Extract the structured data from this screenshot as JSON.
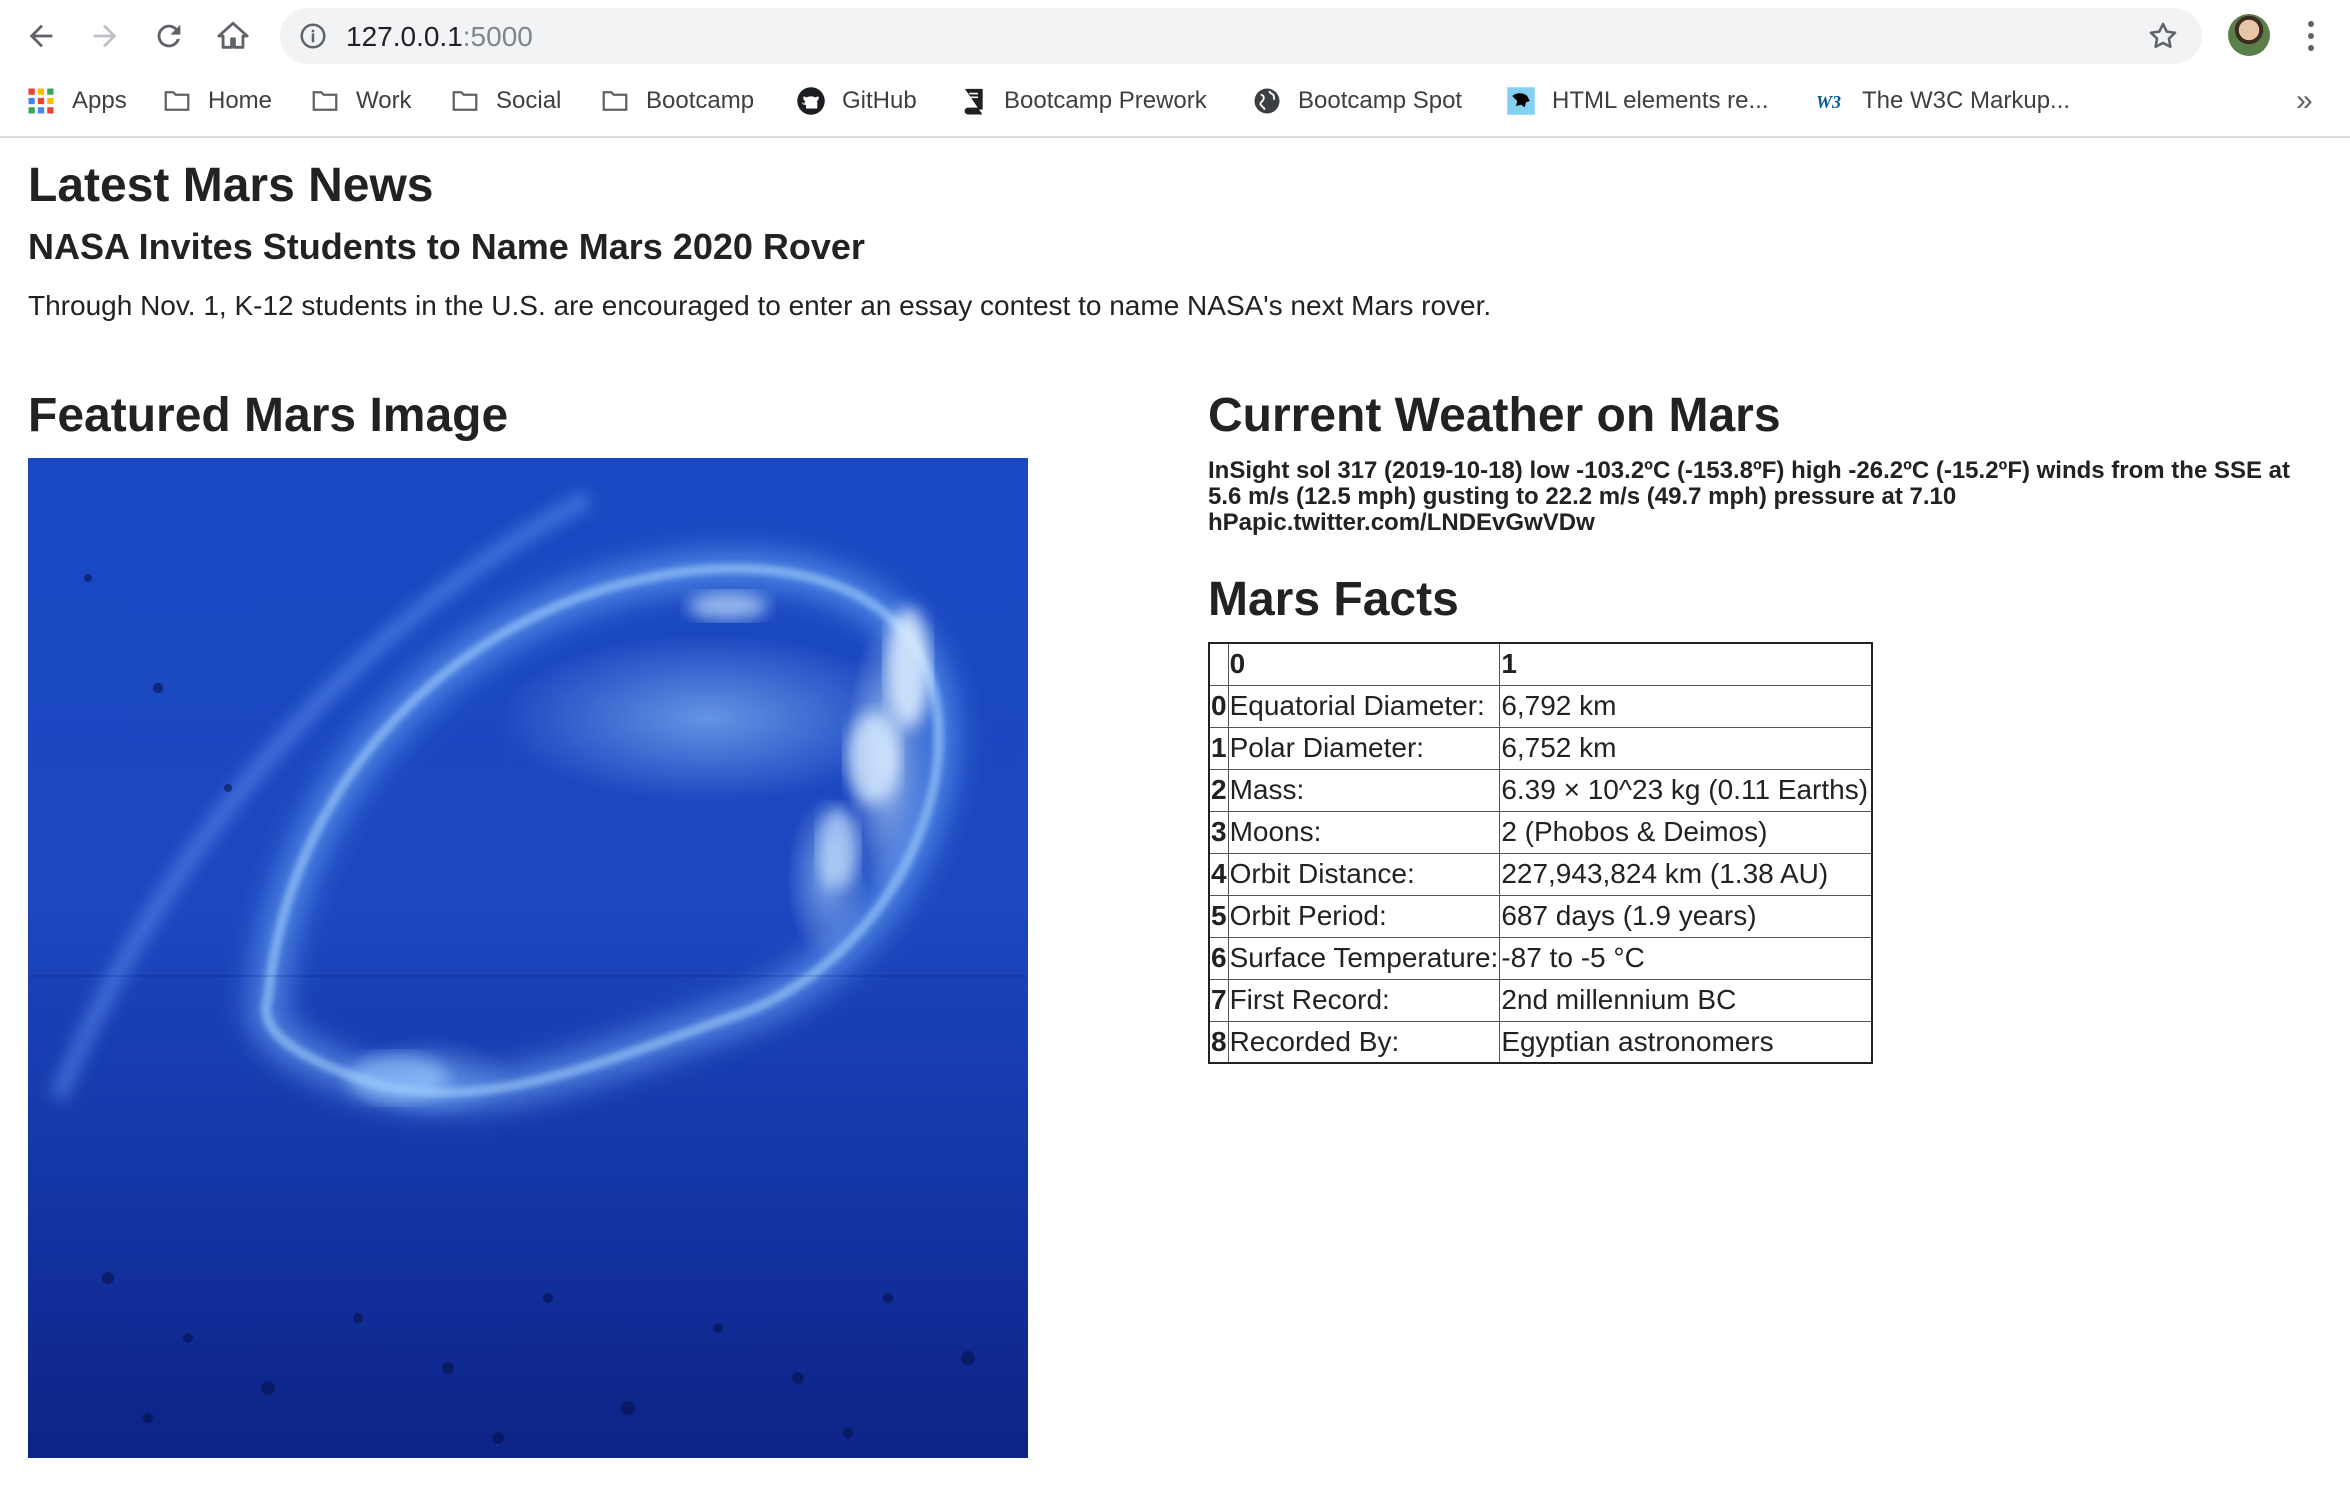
{
  "browser": {
    "url_host": "127.0.0.1",
    "url_port": ":5000",
    "bookmarks": [
      {
        "label": "Apps",
        "icon": "apps-grid-icon"
      },
      {
        "label": "Home",
        "icon": "folder-icon"
      },
      {
        "label": "Work",
        "icon": "folder-icon"
      },
      {
        "label": "Social",
        "icon": "folder-icon"
      },
      {
        "label": "Bootcamp",
        "icon": "folder-icon"
      },
      {
        "label": "GitHub",
        "icon": "github-icon"
      },
      {
        "label": "Bootcamp Prework",
        "icon": "book-icon"
      },
      {
        "label": "Bootcamp Spot",
        "icon": "globe-icon"
      },
      {
        "label": "HTML elements re...",
        "icon": "mdn-icon"
      },
      {
        "label": "The W3C Markup...",
        "icon": "w3c-icon"
      }
    ],
    "more_glyph": "»"
  },
  "news": {
    "heading": "Latest Mars News",
    "title": "NASA Invites Students to Name Mars 2020 Rover",
    "paragraph": "Through Nov. 1, K-12 students in the U.S. are encouraged to enter an essay contest to name NASA's next Mars rover."
  },
  "featured_image": {
    "heading": "Featured Mars Image"
  },
  "weather": {
    "heading": "Current Weather on Mars",
    "text": "InSight sol 317 (2019-10-18) low -103.2ºC (-153.8ºF) high -26.2ºC (-15.2ºF) winds from the SSE at 5.6 m/s (12.5 mph) gusting to 22.2 m/s (49.7 mph) pressure at 7.10 hPapic.twitter.com/LNDEvGwVDw"
  },
  "facts": {
    "heading": "Mars Facts",
    "columns": [
      "0",
      "1"
    ],
    "rows": [
      {
        "index": "0",
        "label": "Equatorial Diameter:",
        "value": "6,792 km"
      },
      {
        "index": "1",
        "label": "Polar Diameter:",
        "value": "6,752 km"
      },
      {
        "index": "2",
        "label": "Mass:",
        "value": "6.39 × 10^23 kg (0.11 Earths)"
      },
      {
        "index": "3",
        "label": "Moons:",
        "value": "2 (Phobos & Deimos)"
      },
      {
        "index": "4",
        "label": "Orbit Distance:",
        "value": "227,943,824 km (1.38 AU)"
      },
      {
        "index": "5",
        "label": "Orbit Period:",
        "value": "687 days (1.9 years)"
      },
      {
        "index": "6",
        "label": "Surface Temperature:",
        "value": "-87 to -5 °C"
      },
      {
        "index": "7",
        "label": "First Record:",
        "value": "2nd millennium BC"
      },
      {
        "index": "8",
        "label": "Recorded By:",
        "value": "Egyptian astronomers"
      }
    ]
  },
  "colors": {
    "text": "#222222",
    "chrome_border": "#dadce0",
    "omnibox_bg": "#f1f3f4",
    "image_blue": "#1a48c2"
  }
}
